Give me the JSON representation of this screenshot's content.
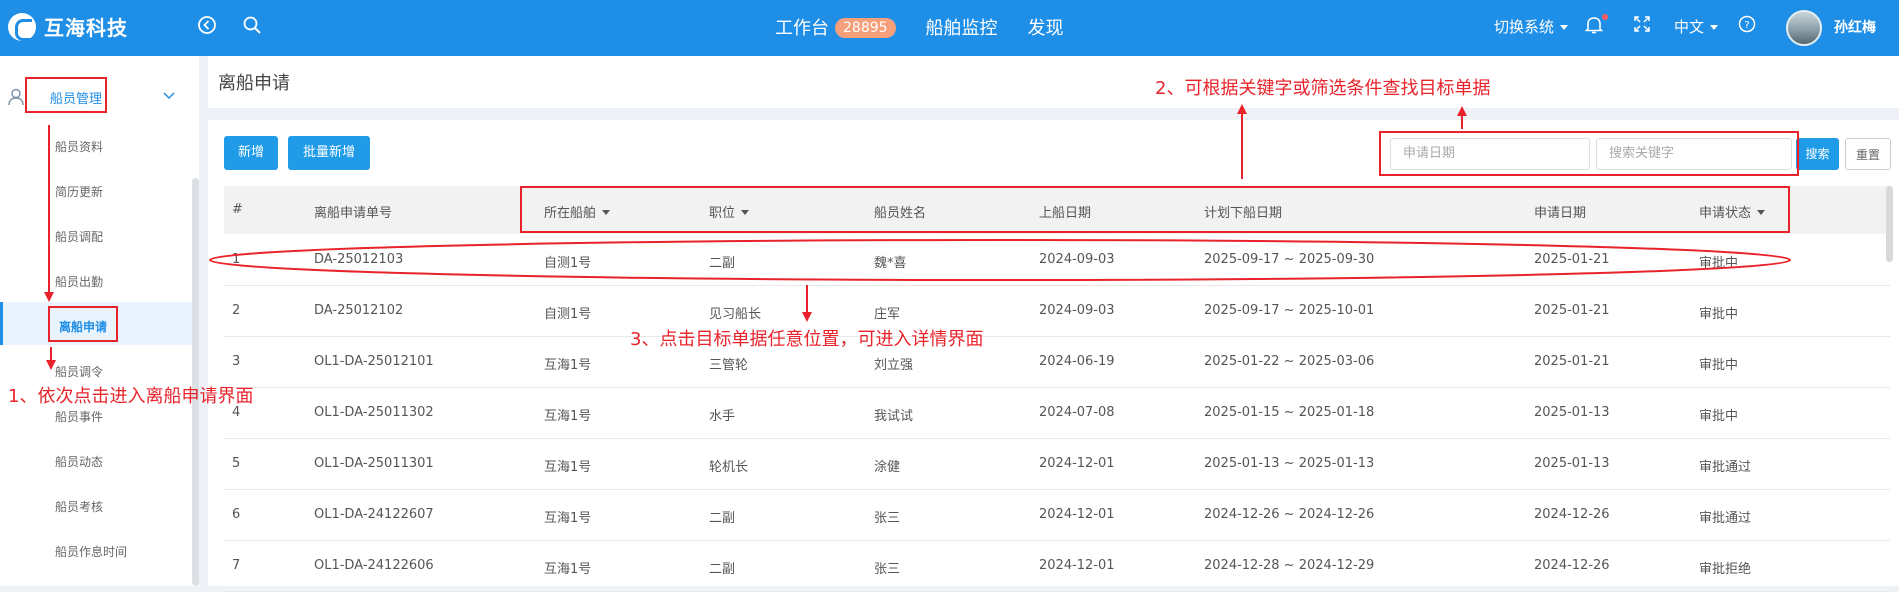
{
  "app": {
    "name": "互海科技"
  },
  "topbar": {
    "nav": [
      {
        "label": "工作台",
        "badge": "28895"
      },
      {
        "label": "船舶监控"
      },
      {
        "label": "发现"
      }
    ],
    "switch_system": "切换系统",
    "language": "中文",
    "username": "孙红梅"
  },
  "sidebar": {
    "group_label": "船员管理",
    "items": [
      "船员资料",
      "简历更新",
      "船员调配",
      "船员出勤",
      "离船申请",
      "船员调令",
      "船员事件",
      "船员动态",
      "船员考核",
      "船员作息时间"
    ],
    "active_index": 4
  },
  "page": {
    "title": "离船申请"
  },
  "toolbar": {
    "add_label": "新增",
    "batch_add_label": "批量新增",
    "date_placeholder": "申请日期",
    "keyword_placeholder": "搜索关键字",
    "search_label": "搜索",
    "reset_label": "重置"
  },
  "table": {
    "headers": [
      "#",
      "离船申请单号",
      "所在船舶",
      "职位",
      "船员姓名",
      "上船日期",
      "计划下船日期",
      "申请日期",
      "申请状态"
    ],
    "rows": [
      [
        "1",
        "DA-25012103",
        "自测1号",
        "二副",
        "魏*喜",
        "2024-09-03",
        "2025-09-17 ~ 2025-09-30",
        "2025-01-21",
        "审批中"
      ],
      [
        "2",
        "DA-25012102",
        "自测1号",
        "见习船长",
        "庄军",
        "2024-09-03",
        "2025-09-17 ~ 2025-10-01",
        "2025-01-21",
        "审批中"
      ],
      [
        "3",
        "OL1-DA-25012101",
        "互海1号",
        "三管轮",
        "刘立强",
        "2024-06-19",
        "2025-01-22 ~ 2025-03-06",
        "2025-01-21",
        "审批中"
      ],
      [
        "4",
        "OL1-DA-25011302",
        "互海1号",
        "水手",
        "我试试",
        "2024-07-08",
        "2025-01-15 ~ 2025-01-18",
        "2025-01-13",
        "审批中"
      ],
      [
        "5",
        "OL1-DA-25011301",
        "互海1号",
        "轮机长",
        "涂健",
        "2024-12-01",
        "2025-01-13 ~ 2025-01-13",
        "2025-01-13",
        "审批通过"
      ],
      [
        "6",
        "OL1-DA-24122607",
        "互海1号",
        "二副",
        "张三",
        "2024-12-01",
        "2024-12-26 ~ 2024-12-26",
        "2024-12-26",
        "审批通过"
      ],
      [
        "7",
        "OL1-DA-24122606",
        "互海1号",
        "二副",
        "张三",
        "2024-12-01",
        "2024-12-28 ~ 2024-12-29",
        "2024-12-26",
        "审批拒绝"
      ]
    ]
  },
  "annotations": {
    "step1": "1、依次点击进入离船申请界面",
    "step2": "2、可根据关键字或筛选条件查找目标单据",
    "step3": "3、点击目标单据任意位置，可进入详情界面",
    "color": "#e8232b"
  },
  "colors": {
    "brand": "#1f8ee6",
    "badge": "#f5a07a"
  }
}
